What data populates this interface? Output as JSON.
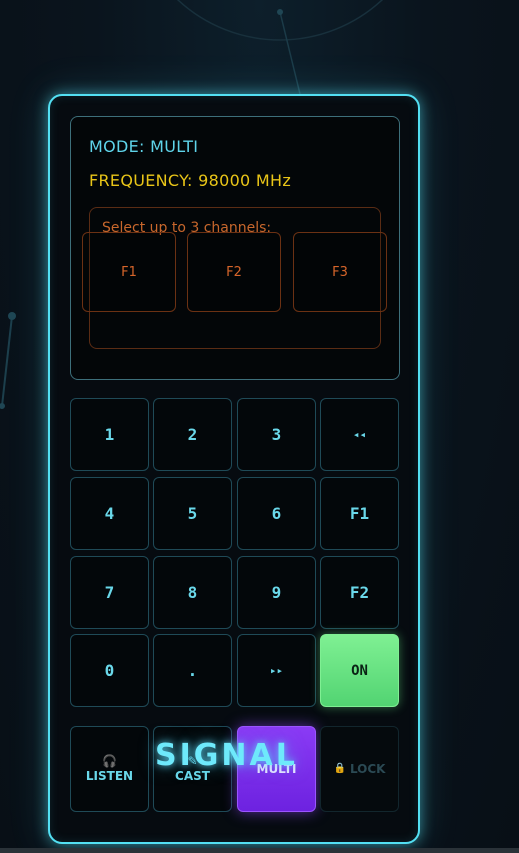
{
  "display": {
    "mode_text": "MODE: MULTI",
    "frequency_text": "FREQUENCY: 98000 MHz",
    "channel_prompt": "Select up to 3 channels:",
    "channels": [
      "F1",
      "F2",
      "F3"
    ]
  },
  "keypad": {
    "row1": [
      "1",
      "2",
      "3",
      "◂◂"
    ],
    "row2": [
      "4",
      "5",
      "6",
      "F1"
    ],
    "row3": [
      "7",
      "8",
      "9",
      "F2"
    ],
    "row4": [
      "0",
      ".",
      "▸▸",
      "ON"
    ]
  },
  "modes": {
    "listen": {
      "label": "LISTEN",
      "icon": "headphones-icon",
      "glyph": "🎧"
    },
    "cast": {
      "label": "CAST",
      "icon": "cast-icon",
      "glyph": "✎"
    },
    "multi": {
      "label": "MULTI"
    },
    "lock": {
      "label": "LOCK",
      "icon": "lock-icon",
      "glyph": "🔒"
    }
  },
  "overlay_title": "SIGNAL",
  "colors": {
    "accent": "#53e0f3",
    "frequency": "#e9c518",
    "channel": "#d6652a",
    "on": "#7ff093",
    "active_mode": "#8a3bf5"
  }
}
